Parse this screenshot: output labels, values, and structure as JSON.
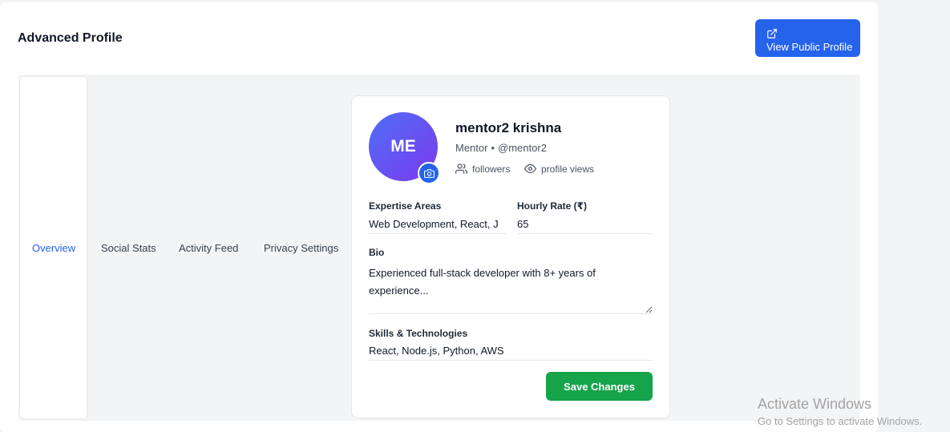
{
  "page": {
    "title": "Advanced Profile",
    "public_profile_label": "View Public Profile"
  },
  "tabs": [
    {
      "label": "Overview",
      "active": true
    },
    {
      "label": "Social Stats",
      "active": false
    },
    {
      "label": "Activity Feed",
      "active": false
    },
    {
      "label": "Privacy Settings",
      "active": false
    }
  ],
  "profile": {
    "initials": "ME",
    "name": "mentor2 krishna",
    "role": "Mentor",
    "separator": "•",
    "username": "@mentor2",
    "followers_label": "followers",
    "views_label": "profile views"
  },
  "form": {
    "expertise_label": "Expertise Areas",
    "expertise_value": "Web Development, React, J",
    "rate_label": "Hourly Rate (₹)",
    "rate_value": "65",
    "bio_label": "Bio",
    "bio_value": "Experienced full-stack developer with 8+ years of experience...",
    "skills_label": "Skills & Technologies",
    "skills_value": "React, Node.js, Python, AWS",
    "save_label": "Save Changes"
  },
  "watermark": {
    "title": "Activate Windows",
    "subtitle": "Go to Settings to activate Windows."
  },
  "colors": {
    "primary": "#2563eb",
    "success": "#16a34a",
    "avatar_gradient": [
      "#4f6ef7",
      "#7c3aed"
    ]
  },
  "icons": [
    "external-link-icon",
    "camera-icon",
    "users-icon",
    "eye-icon",
    "resize-grip-icon"
  ]
}
